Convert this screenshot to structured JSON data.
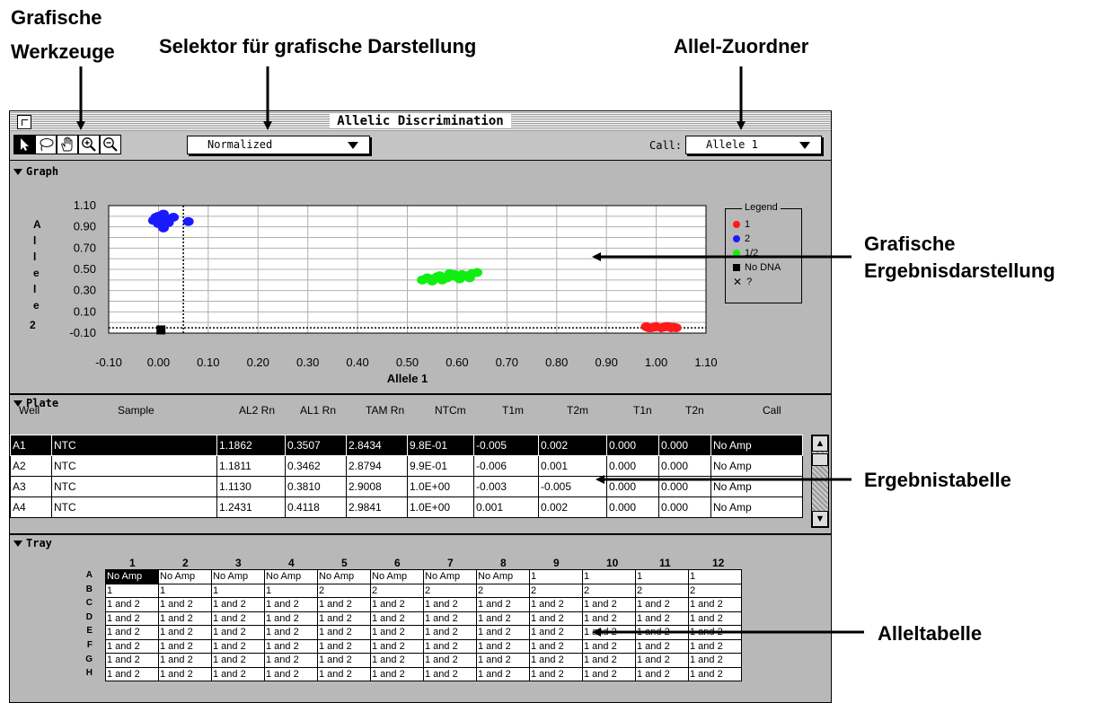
{
  "annotations": {
    "tools_line1": "Grafische",
    "tools_line2": "Werkzeuge",
    "selector": "Selektor für grafische Darstellung",
    "allele_assigner": "Allel-Zuordner",
    "graph_line1": "Grafische",
    "graph_line2": "Ergebnisdarstellung",
    "results_table": "Ergebnistabelle",
    "allele_table": "Alleltabelle"
  },
  "window": {
    "title": "Allelic Discrimination",
    "view_select": "Normalized",
    "call_label": "Call:",
    "call_select": "Allele 1"
  },
  "graph": {
    "section_label": "Graph",
    "ylabel": "Allele 2",
    "xlabel": "Allele 1",
    "legend_title": "Legend",
    "legend": [
      {
        "label": "1",
        "color": "#ff1a1a",
        "marker": "dot"
      },
      {
        "label": "2",
        "color": "#1a1aff",
        "marker": "dot"
      },
      {
        "label": "1/2",
        "color": "#11ee11",
        "marker": "dot"
      },
      {
        "label": "No DNA",
        "color": "#000000",
        "marker": "square"
      },
      {
        "label": "?",
        "color": "#000000",
        "marker": "x"
      }
    ]
  },
  "chart_data": {
    "type": "scatter",
    "xlabel": "Allele 1",
    "ylabel": "Allele 2",
    "xlim": [
      -0.1,
      1.1
    ],
    "ylim": [
      -0.1,
      1.1
    ],
    "x_ticks": [
      "-0.10",
      "0.00",
      "0.10",
      "0.20",
      "0.30",
      "0.40",
      "0.50",
      "0.60",
      "0.70",
      "0.80",
      "0.90",
      "1.00",
      "1.10"
    ],
    "y_ticks": [
      "1.10",
      "0.90",
      "0.70",
      "0.50",
      "0.30",
      "0.10",
      "-0.10"
    ],
    "grid": true,
    "legend_position": "right",
    "series": [
      {
        "name": "1",
        "color": "#ff1a1a",
        "points": [
          [
            0.98,
            -0.04
          ],
          [
            0.99,
            -0.05
          ],
          [
            1.0,
            -0.04
          ],
          [
            1.01,
            -0.05
          ],
          [
            1.02,
            -0.04
          ],
          [
            1.03,
            -0.05
          ],
          [
            0.995,
            -0.045
          ],
          [
            1.015,
            -0.045
          ],
          [
            1.025,
            -0.04
          ],
          [
            1.035,
            -0.045
          ],
          [
            1.04,
            -0.05
          ],
          [
            0.985,
            -0.05
          ]
        ]
      },
      {
        "name": "2",
        "color": "#1a1aff",
        "points": [
          [
            0.0,
            1.0
          ],
          [
            0.01,
            0.98
          ],
          [
            -0.01,
            0.96
          ],
          [
            0.02,
            0.97
          ],
          [
            0.0,
            0.93
          ],
          [
            0.01,
            1.02
          ],
          [
            0.03,
            0.99
          ],
          [
            0.02,
            0.94
          ],
          [
            0.01,
            0.89
          ],
          [
            -0.005,
            0.99
          ],
          [
            0.015,
            0.95
          ],
          [
            0.06,
            0.95
          ]
        ]
      },
      {
        "name": "1/2",
        "color": "#11ee11",
        "points": [
          [
            0.53,
            0.4
          ],
          [
            0.55,
            0.41
          ],
          [
            0.56,
            0.43
          ],
          [
            0.57,
            0.4
          ],
          [
            0.58,
            0.42
          ],
          [
            0.59,
            0.44
          ],
          [
            0.6,
            0.43
          ],
          [
            0.61,
            0.45
          ],
          [
            0.62,
            0.44
          ],
          [
            0.63,
            0.46
          ],
          [
            0.64,
            0.47
          ],
          [
            0.54,
            0.42
          ],
          [
            0.565,
            0.44
          ],
          [
            0.585,
            0.46
          ],
          [
            0.605,
            0.41
          ],
          [
            0.625,
            0.42
          ],
          [
            0.595,
            0.45
          ],
          [
            0.55,
            0.39
          ]
        ]
      },
      {
        "name": "No DNA",
        "color": "#000000",
        "points": [
          [
            0.005,
            -0.07
          ]
        ]
      }
    ]
  },
  "plate": {
    "section_label": "Plate",
    "columns": [
      "Well",
      "Sample",
      "AL2 Rn",
      "AL1 Rn",
      "TAM Rn",
      "NTCm",
      "T1m",
      "T2m",
      "T1n",
      "T2n",
      "Call"
    ],
    "rows": [
      [
        "A1",
        "NTC",
        "1.1862",
        "0.3507",
        "2.8434",
        "9.8E-01",
        "-0.005",
        "0.002",
        "0.000",
        "0.000",
        "No Amp"
      ],
      [
        "A2",
        "NTC",
        "1.1811",
        "0.3462",
        "2.8794",
        "9.9E-01",
        "-0.006",
        "0.001",
        "0.000",
        "0.000",
        "No Amp"
      ],
      [
        "A3",
        "NTC",
        "1.1130",
        "0.3810",
        "2.9008",
        "1.0E+00",
        "-0.003",
        "-0.005",
        "0.000",
        "0.000",
        "No Amp"
      ],
      [
        "A4",
        "NTC",
        "1.2431",
        "0.4118",
        "2.9841",
        "1.0E+00",
        "0.001",
        "0.002",
        "0.000",
        "0.000",
        "No Amp"
      ]
    ]
  },
  "tray": {
    "section_label": "Tray",
    "columns": [
      "1",
      "2",
      "3",
      "4",
      "5",
      "6",
      "7",
      "8",
      "9",
      "10",
      "11",
      "12"
    ],
    "row_labels": [
      "A",
      "B",
      "C",
      "D",
      "E",
      "F",
      "G",
      "H"
    ],
    "rows": [
      [
        "No Amp",
        "No Amp",
        "No Amp",
        "No Amp",
        "No Amp",
        "No Amp",
        "No Amp",
        "No Amp",
        "1",
        "1",
        "1",
        "1"
      ],
      [
        "1",
        "1",
        "1",
        "1",
        "2",
        "2",
        "2",
        "2",
        "2",
        "2",
        "2",
        "2"
      ],
      [
        "1 and 2",
        "1 and 2",
        "1 and 2",
        "1 and 2",
        "1 and 2",
        "1 and 2",
        "1 and 2",
        "1 and 2",
        "1 and 2",
        "1 and 2",
        "1 and 2",
        "1 and 2"
      ],
      [
        "1 and 2",
        "1 and 2",
        "1 and 2",
        "1 and 2",
        "1 and 2",
        "1 and 2",
        "1 and 2",
        "1 and 2",
        "1 and 2",
        "1 and 2",
        "1 and 2",
        "1 and 2"
      ],
      [
        "1 and 2",
        "1 and 2",
        "1 and 2",
        "1 and 2",
        "1 and 2",
        "1 and 2",
        "1 and 2",
        "1 and 2",
        "1 and 2",
        "1 and 2",
        "1 and 2",
        "1 and 2"
      ],
      [
        "1 and 2",
        "1 and 2",
        "1 and 2",
        "1 and 2",
        "1 and 2",
        "1 and 2",
        "1 and 2",
        "1 and 2",
        "1 and 2",
        "1 and 2",
        "1 and 2",
        "1 and 2"
      ],
      [
        "1 and 2",
        "1 and 2",
        "1 and 2",
        "1 and 2",
        "1 and 2",
        "1 and 2",
        "1 and 2",
        "1 and 2",
        "1 and 2",
        "1 and 2",
        "1 and 2",
        "1 and 2"
      ],
      [
        "1 and 2",
        "1 and 2",
        "1 and 2",
        "1 and 2",
        "1 and 2",
        "1 and 2",
        "1 and 2",
        "1 and 2",
        "1 and 2",
        "1 and 2",
        "1 and 2",
        "1 and 2"
      ]
    ]
  }
}
